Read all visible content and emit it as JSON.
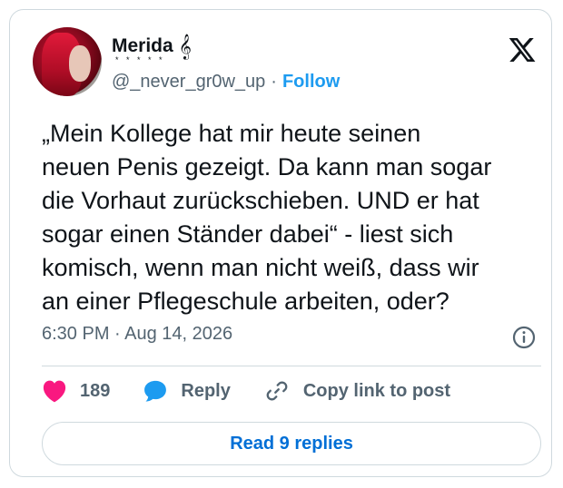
{
  "author": {
    "display_name": "Merida",
    "name_decoration": "𝄞",
    "name_sub_stars": "* * * * *",
    "handle": "@_never_gr0w_up",
    "separator": "·",
    "follow_label": "Follow"
  },
  "tweet": {
    "text": "„Mein Kollege hat mir heute seinen\nneuen Penis gezeigt. Da kann man sogar\ndie Vorhaut zurückschieben. UND er hat\nsogar einen Ständer dabei“ - liest sich\nkomisch, wenn man nicht weiß, dass wir\nan einer Pflegeschule arbeiten, oder?",
    "timestamp": "6:30 PM · Aug 14, 2026"
  },
  "actions": {
    "likes_count": "189",
    "reply_label": "Reply",
    "copy_link_label": "Copy link to post"
  },
  "replies_button_label": "Read 9 replies",
  "colors": {
    "accent": "#1d9bf0",
    "like": "#f91880",
    "reply_bubble": "#1d9bf0",
    "muted_text": "#536471",
    "border": "#cfd9de"
  },
  "icons": {
    "brand": "x-logo-icon",
    "info": "info-icon",
    "like": "heart-icon",
    "reply": "reply-bubble-icon",
    "copy_link": "link-icon"
  }
}
